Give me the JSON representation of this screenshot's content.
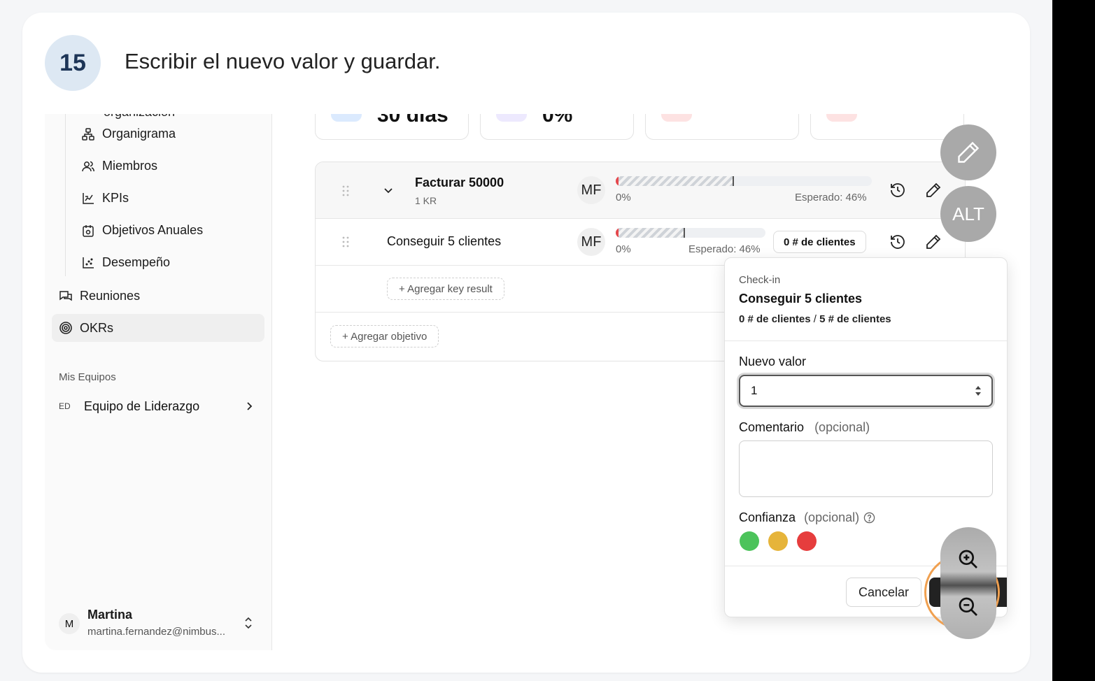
{
  "step": {
    "number": "15",
    "instruction": "Escribir el nuevo valor y guardar."
  },
  "sidebar": {
    "cut_item": "organización",
    "sub_items": [
      {
        "label": "Organigrama",
        "icon": "org-chart-icon"
      },
      {
        "label": "Miembros",
        "icon": "users-icon"
      },
      {
        "label": "KPIs",
        "icon": "chart-line-icon"
      },
      {
        "label": "Objetivos Anuales",
        "icon": "calendar-target-icon"
      },
      {
        "label": "Desempeño",
        "icon": "scatter-chart-icon"
      }
    ],
    "items": [
      {
        "label": "Reuniones",
        "icon": "chat-bubbles-icon"
      },
      {
        "label": "OKRs",
        "icon": "target-icon",
        "active": true
      }
    ],
    "section_title": "Mis Equipos",
    "team": {
      "badge": "ED",
      "label": "Equipo de Liderazgo"
    },
    "user": {
      "initial": "M",
      "name": "Martina",
      "email": "martina.fernandez@nimbus..."
    }
  },
  "stats": [
    {
      "value": "30 días",
      "pill_color": "#dbeafe"
    },
    {
      "value": "0%",
      "pill_color": "#ede9fe"
    },
    {
      "value": "",
      "pill_color": "#fde2e2"
    },
    {
      "value": "",
      "pill_color": "#fde2e2"
    }
  ],
  "objective": {
    "title": "Facturar 50000",
    "subtitle": "1 KR",
    "owner": "MF",
    "progress_label": "0%",
    "expected_label": "Esperado: 46%",
    "progress": 0,
    "expected": 0.46
  },
  "key_result": {
    "title": "Conseguir 5 clientes",
    "owner": "MF",
    "progress_label": "0%",
    "expected_label": "Esperado: 46%",
    "progress": 0,
    "expected": 0.46,
    "metric": "0 # de clientes"
  },
  "buttons": {
    "add_kr": "+ Agregar key result",
    "add_objective": "+ Agregar objetivo"
  },
  "checkin": {
    "kicker": "Check-in",
    "title": "Conseguir 5 clientes",
    "current": "0 # de clientes",
    "separator": "/",
    "target": "5 # de clientes",
    "new_value_label": "Nuevo valor",
    "new_value": "1",
    "comment_label": "Comentario",
    "comment_optional": "(opcional)",
    "confidence_label": "Confianza",
    "confidence_optional": "(opcional)",
    "confidence_colors": [
      "#4cc35b",
      "#e6b43a",
      "#e63d3d"
    ],
    "cancel": "Cancelar"
  },
  "overlay": {
    "alt_label": "ALT"
  },
  "colors": {
    "accent_ring": "#f0a050",
    "bar_red": "#e5484d"
  }
}
